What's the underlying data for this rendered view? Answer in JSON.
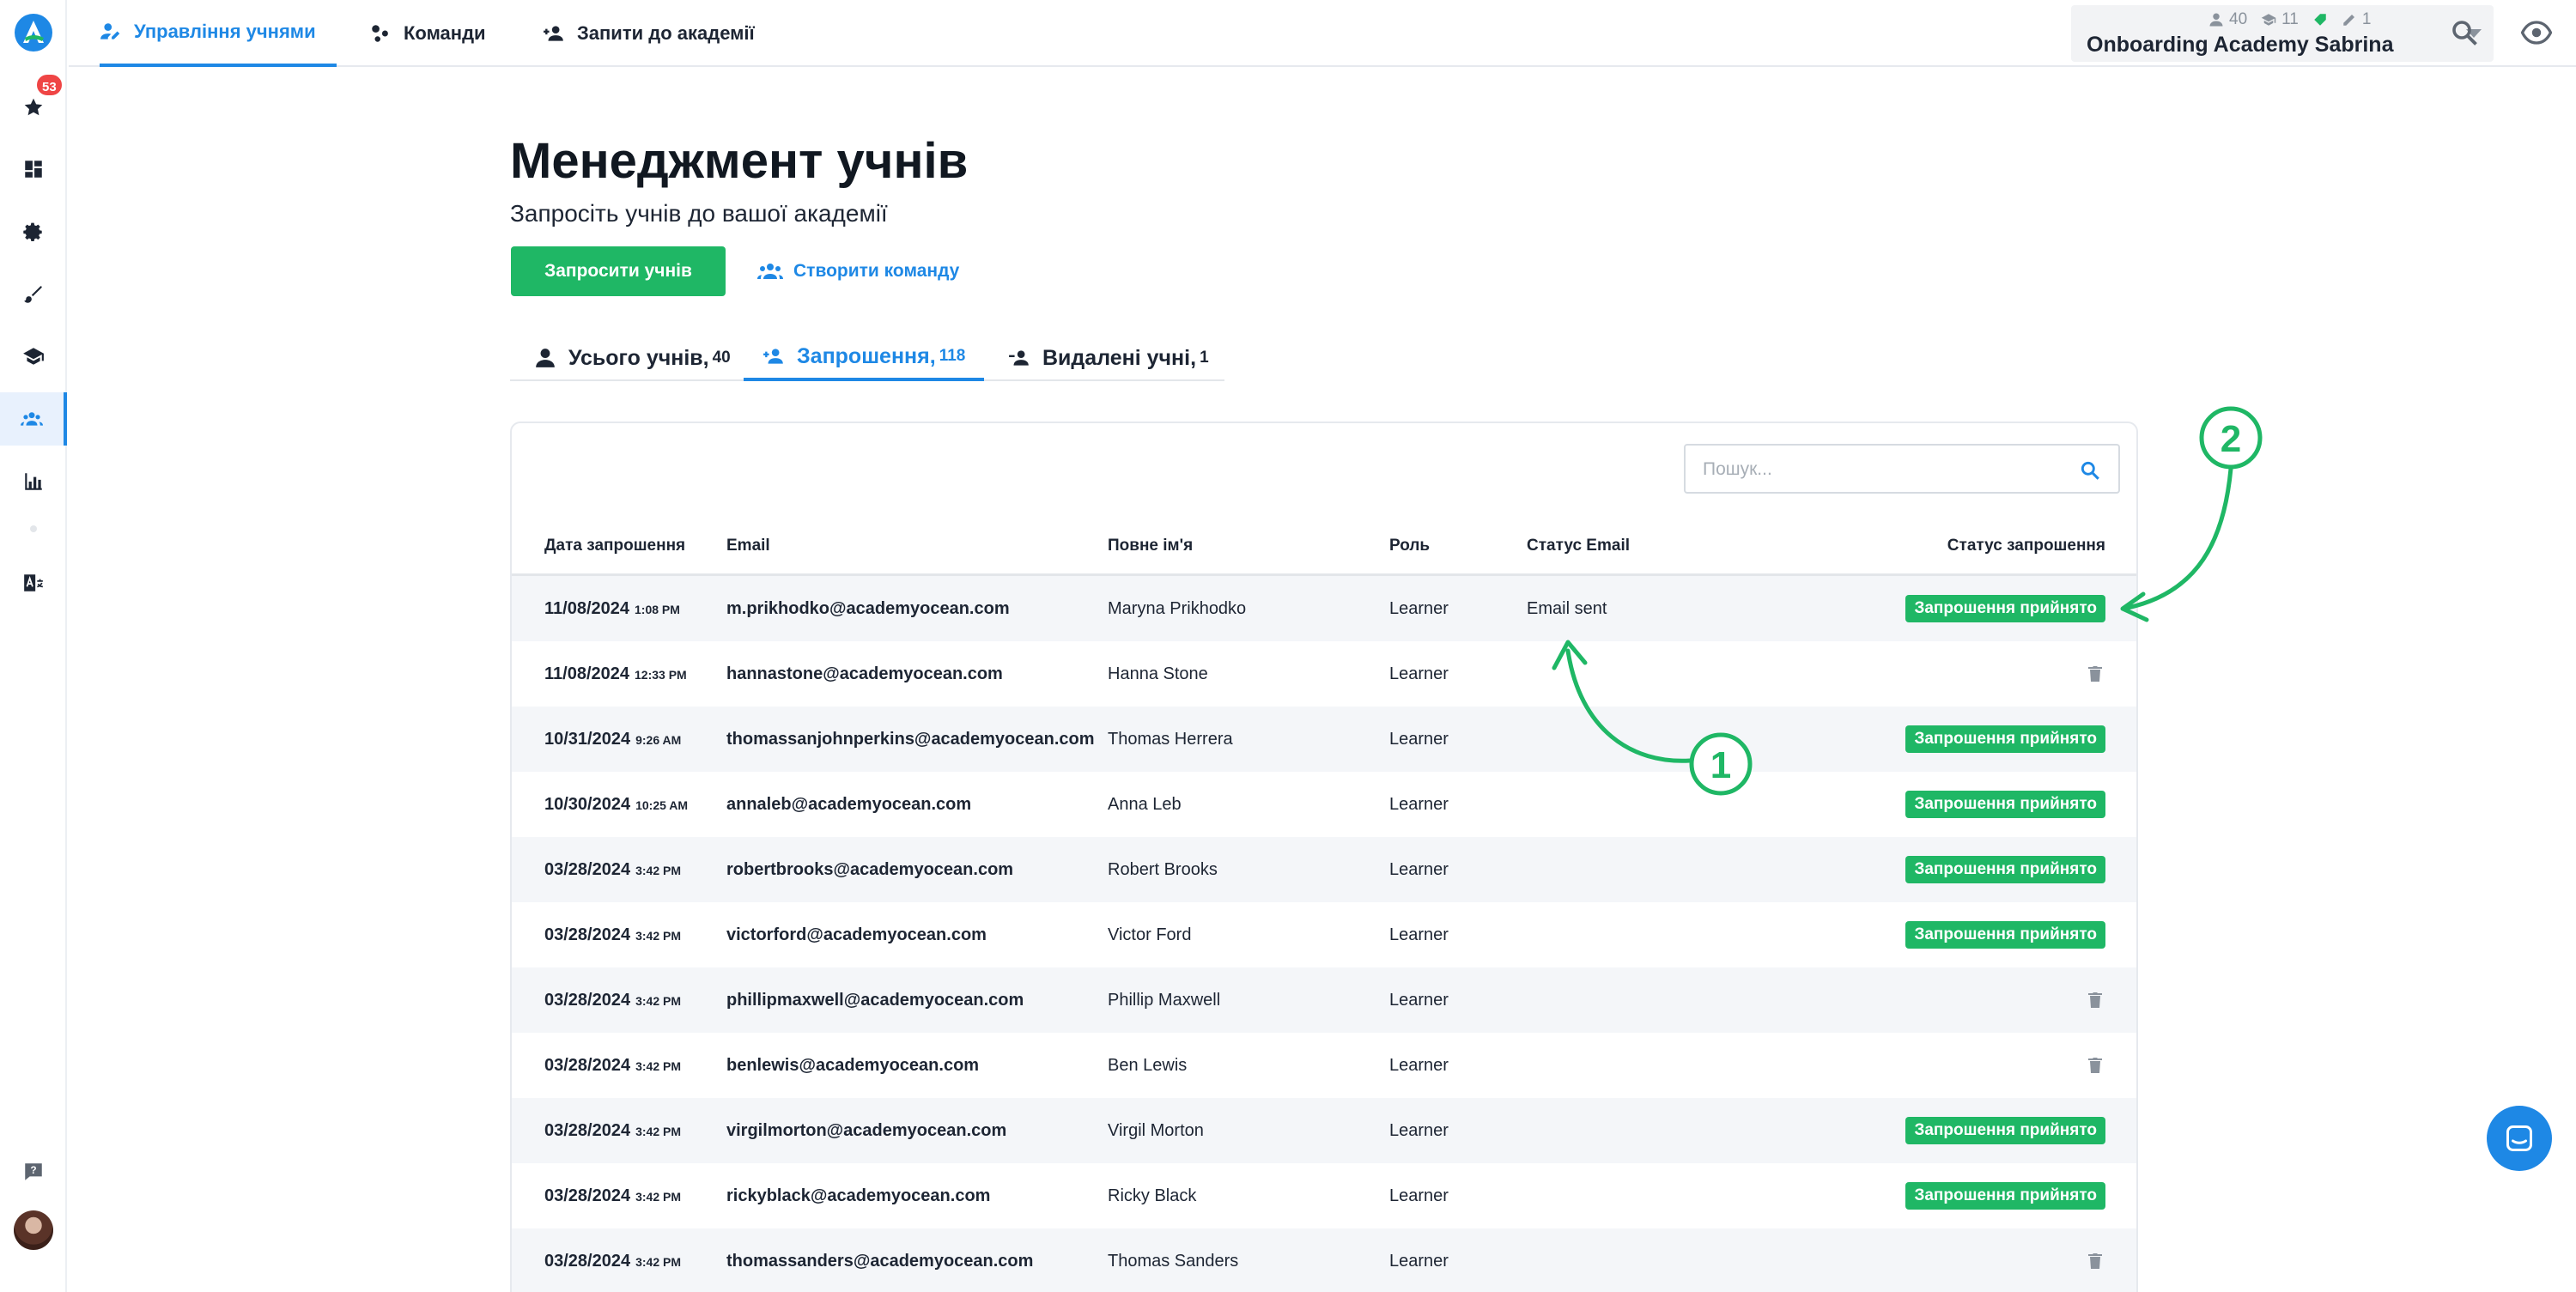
{
  "sidebar": {
    "badge_count": "53",
    "items": [
      {
        "name": "star-icon"
      },
      {
        "name": "dashboard-icon"
      },
      {
        "name": "gear-icon"
      },
      {
        "name": "brush-icon"
      },
      {
        "name": "graduation-cap-icon"
      },
      {
        "name": "users-icon",
        "active": true
      },
      {
        "name": "bar-chart-icon"
      },
      {
        "name": "translate-icon"
      }
    ]
  },
  "topnav": {
    "tabs": [
      {
        "label": "Управління учнями",
        "active": true
      },
      {
        "label": "Команди"
      },
      {
        "label": "Запити до академії"
      }
    ]
  },
  "account": {
    "learners": "40",
    "courses": "11",
    "instructors": "1",
    "name": "Onboarding Academy Sabrina"
  },
  "page": {
    "title": "Менеджмент учнів",
    "subtitle": "Запросіть учнів до вашої академії",
    "invite_button": "Запросити учнів",
    "team_button": "Створити команду"
  },
  "subtabs": [
    {
      "label": "Усього учнів,",
      "count": "40"
    },
    {
      "label": "Запрошення,",
      "count": "118",
      "active": true
    },
    {
      "label": "Видалені учні,",
      "count": "1"
    }
  ],
  "search": {
    "placeholder": "Пошук..."
  },
  "table": {
    "columns": [
      "Дата запрошення",
      "Email",
      "Повне ім'я",
      "Роль",
      "Статус Email",
      "Статус запрошення"
    ],
    "accepted_label": "Запрошення прийнято",
    "rows": [
      {
        "date": "11/08/2024",
        "time": "1:08 PM",
        "email": "m.prikhodko@academyocean.com",
        "name": "Maryna Prikhodko",
        "role": "Learner",
        "email_status": "Email sent",
        "accepted": true
      },
      {
        "date": "11/08/2024",
        "time": "12:33 PM",
        "email": "hannastone@academyocean.com",
        "name": "Hanna Stone",
        "role": "Learner",
        "email_status": "",
        "accepted": false
      },
      {
        "date": "10/31/2024",
        "time": "9:26 AM",
        "email": "thomassanjohnperkins@academyocean.com",
        "name": "Thomas Herrera",
        "role": "Learner",
        "email_status": "",
        "accepted": true
      },
      {
        "date": "10/30/2024",
        "time": "10:25 AM",
        "email": "annaleb@academyocean.com",
        "name": "Anna Leb",
        "role": "Learner",
        "email_status": "",
        "accepted": true
      },
      {
        "date": "03/28/2024",
        "time": "3:42 PM",
        "email": "robertbrooks@academyocean.com",
        "name": "Robert Brooks",
        "role": "Learner",
        "email_status": "",
        "accepted": true
      },
      {
        "date": "03/28/2024",
        "time": "3:42 PM",
        "email": "victorford@academyocean.com",
        "name": "Victor Ford",
        "role": "Learner",
        "email_status": "",
        "accepted": true
      },
      {
        "date": "03/28/2024",
        "time": "3:42 PM",
        "email": "phillipmaxwell@academyocean.com",
        "name": "Phillip Maxwell",
        "role": "Learner",
        "email_status": "",
        "accepted": false
      },
      {
        "date": "03/28/2024",
        "time": "3:42 PM",
        "email": "benlewis@academyocean.com",
        "name": "Ben Lewis",
        "role": "Learner",
        "email_status": "",
        "accepted": false
      },
      {
        "date": "03/28/2024",
        "time": "3:42 PM",
        "email": "virgilmorton@academyocean.com",
        "name": "Virgil Morton",
        "role": "Learner",
        "email_status": "",
        "accepted": true
      },
      {
        "date": "03/28/2024",
        "time": "3:42 PM",
        "email": "rickyblack@academyocean.com",
        "name": "Ricky Black",
        "role": "Learner",
        "email_status": "",
        "accepted": true
      },
      {
        "date": "03/28/2024",
        "time": "3:42 PM",
        "email": "thomassanders@academyocean.com",
        "name": "Thomas Sanders",
        "role": "Learner",
        "email_status": "",
        "accepted": false
      }
    ]
  },
  "annotations": {
    "marker_1": "1",
    "marker_2": "2",
    "color": "#1fb765"
  },
  "colors": {
    "accent": "#1e88e5",
    "success": "#1fb765",
    "badge": "#ef4545"
  }
}
